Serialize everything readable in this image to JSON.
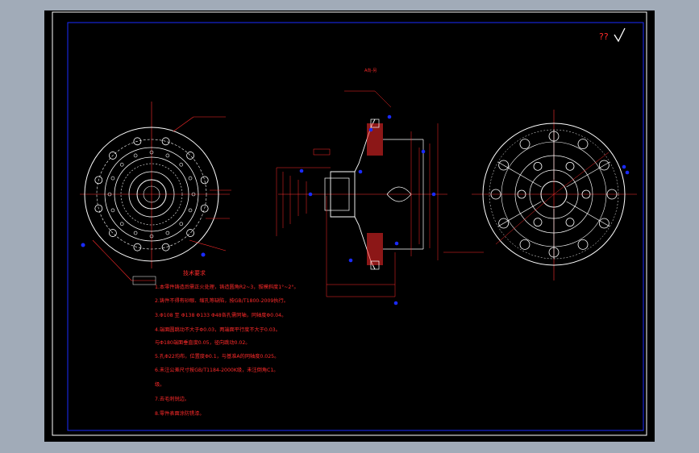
{
  "viewer": {
    "background_color": "#a1abb8",
    "canvas_color": "#000000"
  },
  "drawing": {
    "roughness_symbol": "??",
    "section_label": "A向-另",
    "requirements_title": "技术要求",
    "requirements": [
      "1.本零件铸造后需正火处理，铸造圆角R2~3，拔模斜度1°~2°。",
      "2.铸件不得有砂眼、缩孔等缺陷，按GB/T1800-2009执行。",
      "3.Φ108  至  Φ138  Φ133  Φ48各孔需同轴，同轴度Φ0.04。",
      "4.端面圆跳动不大于Φ0.03，两端面平行度不大于0.03。",
      "与Φ180端面垂直度0.05，径向跳动0.02。",
      "5.孔Φ22均布，位置度Φ0.1，与基准A的同轴度0.025。",
      "6.未注公差尺寸按GB/T1184-2000K级，未注倒角C1。",
      "级。",
      "7.去毛刺锐边。",
      "8.零件表面涂防锈漆。"
    ],
    "colors": {
      "outline": "#ffffff",
      "dimension": "#ff2a2a",
      "centerline": "#ff3030",
      "marker": "#1a2bff",
      "border": "#1a2bff",
      "frame": "#ffffff"
    }
  }
}
